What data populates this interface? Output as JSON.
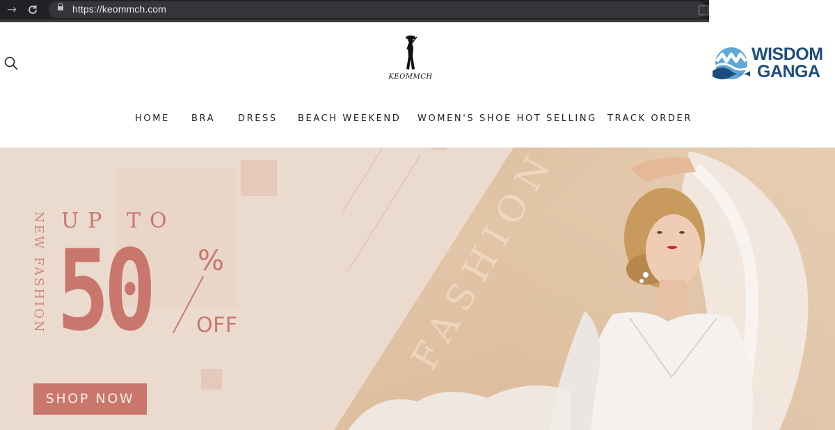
{
  "browser": {
    "url": "https://keommch.com",
    "icons": [
      "forward-arrow-icon",
      "reload-icon",
      "lock-icon",
      "share-icon"
    ]
  },
  "watermark": {
    "line1": "WISDOM",
    "line2": "GANGA"
  },
  "header": {
    "logo_text": "KEOMMCH",
    "search_icon": "search-icon"
  },
  "nav": {
    "items": [
      "HOME",
      "BRA",
      "DRESS",
      "BEACH WEEKEND",
      "WOMEN'S SHOE HOT SELLING",
      "TRACK ORDER"
    ]
  },
  "hero": {
    "vertical_text": "NEW FASHION",
    "up_to": "UP TO",
    "amount": "50",
    "percent": "%",
    "off": "OFF",
    "cta": "SHOP NOW",
    "background_word": "FASHION",
    "colors": {
      "accent": "#c9776d",
      "background": "#ebdbce",
      "photo_bg": "#dcbb9b"
    }
  }
}
